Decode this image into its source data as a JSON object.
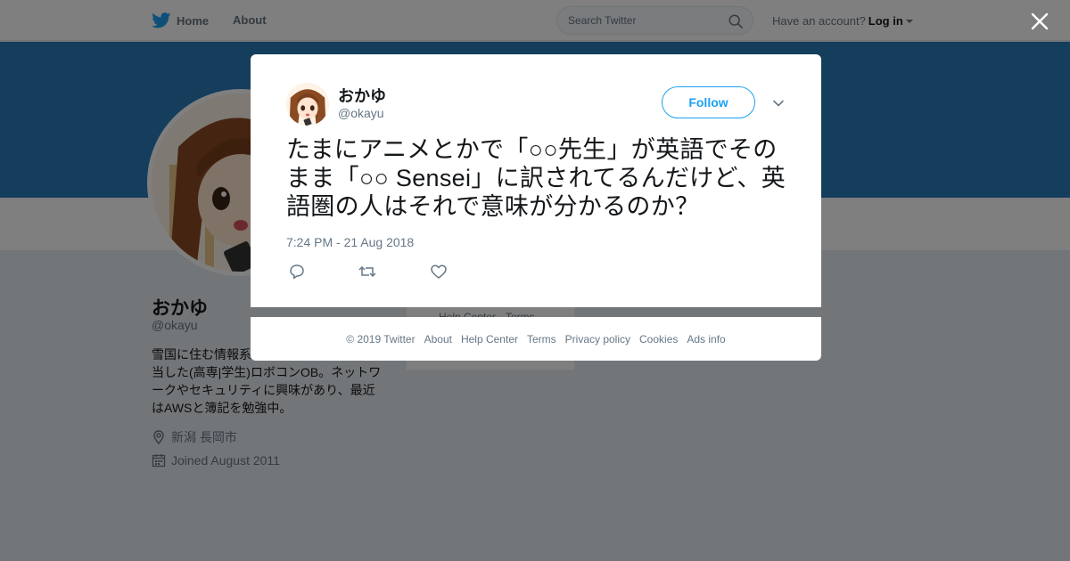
{
  "topbar": {
    "home_label": "Home",
    "about_label": "About",
    "search_placeholder": "Search Twitter",
    "have_account": "Have an account?",
    "login_label": "Log in"
  },
  "profile": {
    "name": "おかゆ",
    "handle": "@okayu",
    "bio": "雪国に住む情報系\n当した(高専|学生)ロボコンOB。ネットワ\nークやセキュリティに興味があり、最近\nはAWSと簿記を勉強中。",
    "location": "新潟 長岡市",
    "joined": "Joined August 2011"
  },
  "background_footer": {
    "help_center": "Help Center",
    "terms": "Terms"
  },
  "tweet": {
    "author_name": "おかゆ",
    "author_handle": "@okayu",
    "follow_label": "Follow",
    "text": "たまにアニメとかで「○○先生」が英語でそのまま「○○ Sensei」に訳されてるんだけど、英語圏の人はそれで意味が分かるのか？",
    "timestamp": "7:24 PM - 21 Aug 2018"
  },
  "footer": {
    "links": [
      "© 2019 Twitter",
      "About",
      "Help Center",
      "Terms",
      "Privacy policy",
      "Cookies",
      "Ads info"
    ]
  },
  "colors": {
    "twitter_blue": "#1da1f2",
    "banner": "#2b7bb9",
    "overlay": "rgba(0,0,0,0.5)"
  },
  "icons": [
    "twitter-bird-icon",
    "search-icon",
    "close-icon",
    "chevron-down-icon",
    "reply-icon",
    "retweet-icon",
    "like-icon",
    "location-icon",
    "calendar-icon"
  ]
}
